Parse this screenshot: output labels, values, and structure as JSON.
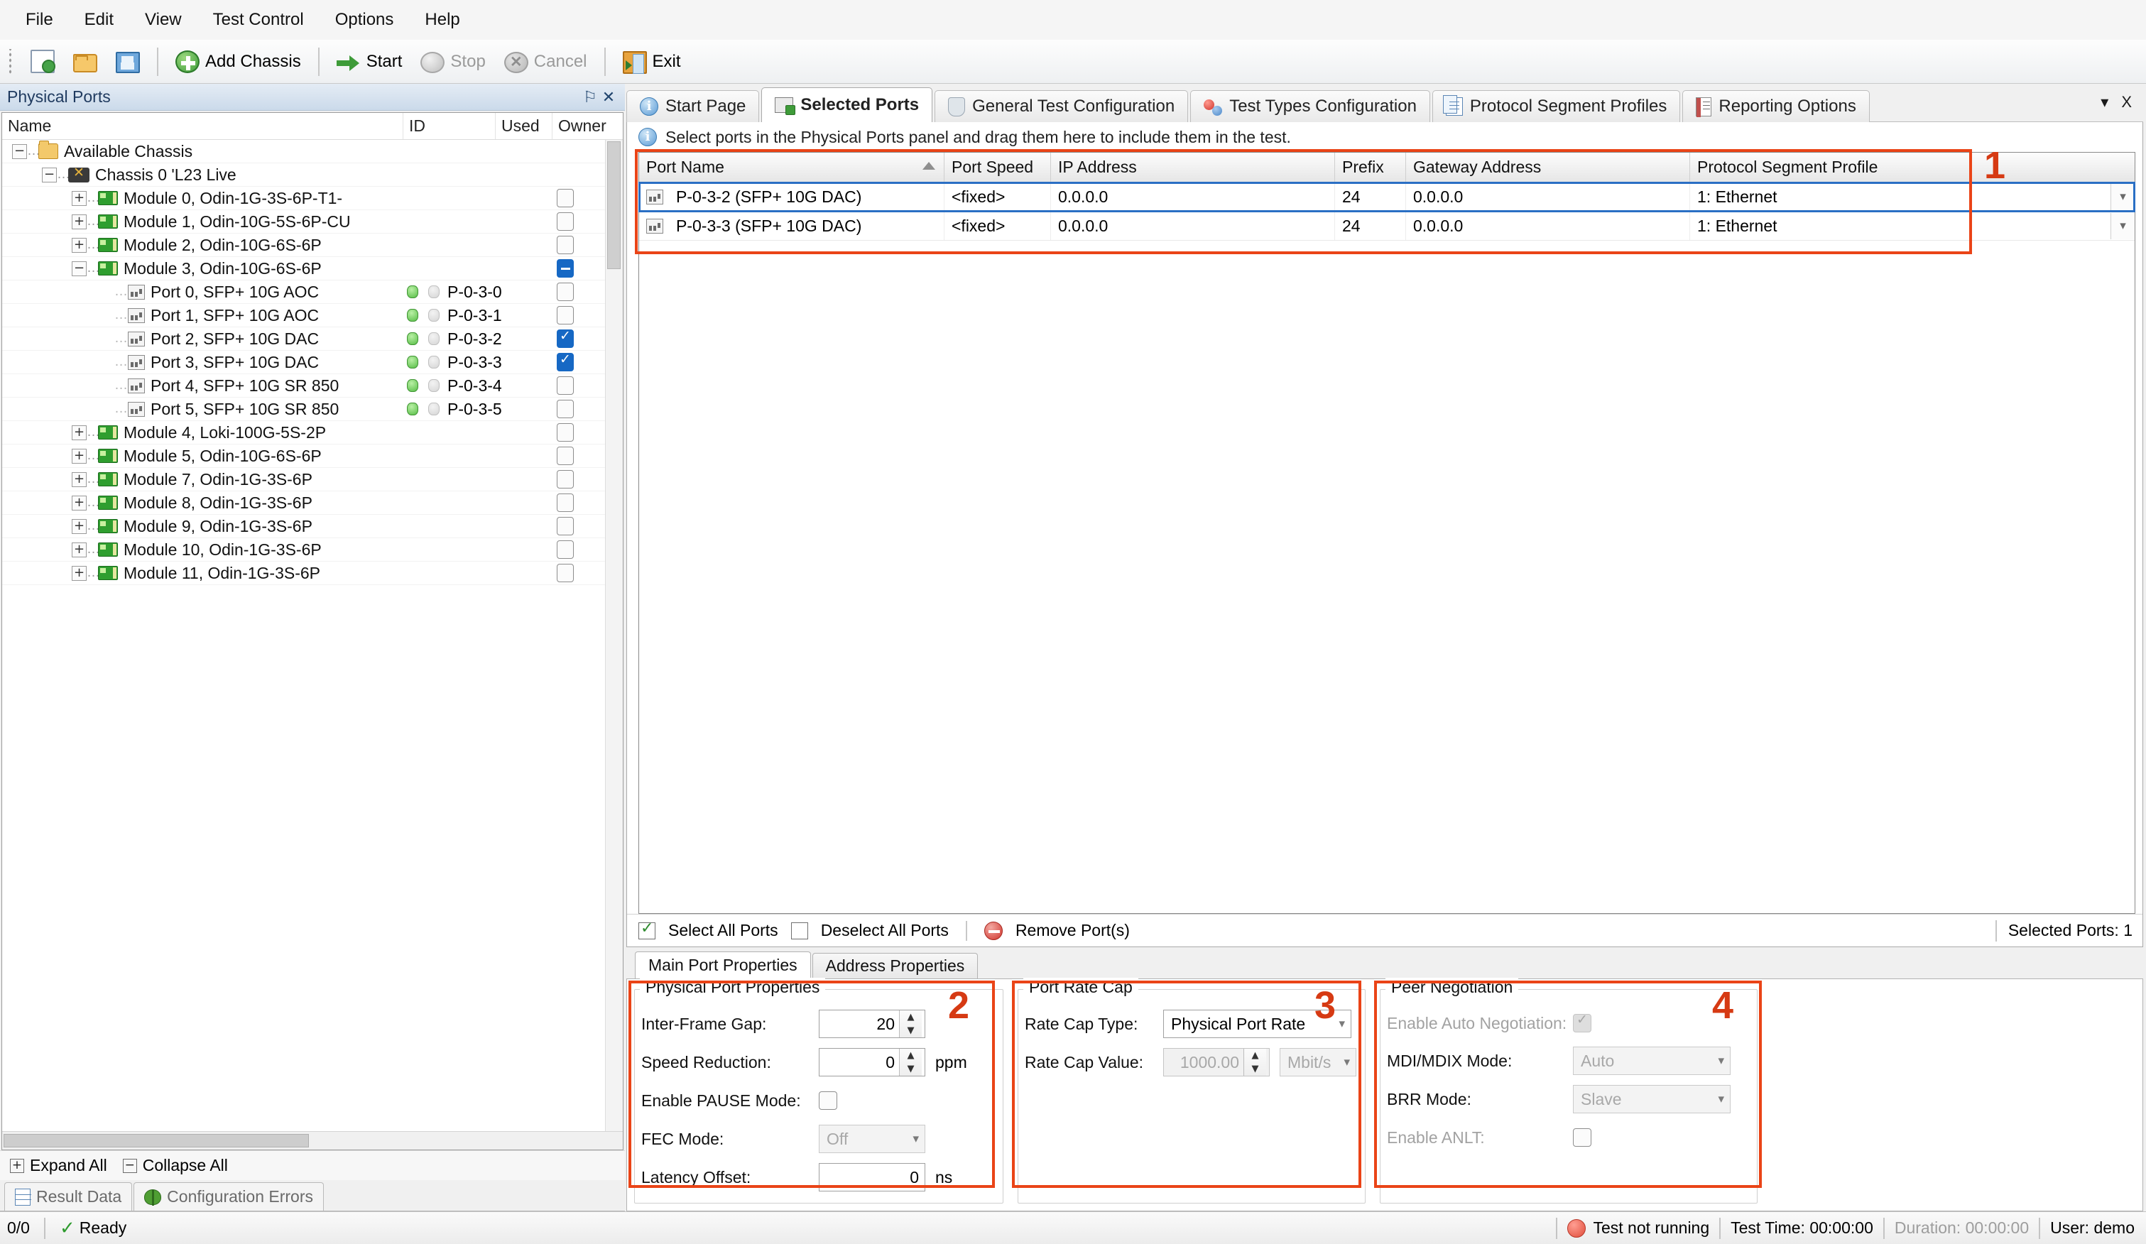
{
  "menu": {
    "items": [
      "File",
      "Edit",
      "View",
      "Test Control",
      "Options",
      "Help"
    ]
  },
  "toolbar": {
    "new_label": "",
    "open_label": "",
    "save_label": "",
    "add_chassis_label": "Add Chassis",
    "start_label": "Start",
    "stop_label": "Stop",
    "cancel_label": "Cancel",
    "exit_label": "Exit"
  },
  "physical_ports_panel": {
    "title": "Physical Ports",
    "pin_icon": "⚐",
    "close_icon": "✕",
    "columns": [
      "Name",
      "ID",
      "Used",
      "Owner"
    ],
    "rows": [
      {
        "label": "Available Chassis",
        "level": 0,
        "icon": "folder-icon",
        "expander": "−",
        "id": "",
        "used": "none",
        "led": false
      },
      {
        "label": "Chassis 0 'L23 Live",
        "level": 1,
        "icon": "chassis-icon",
        "expander": "−",
        "id": "",
        "used": "none",
        "led": false
      },
      {
        "label": "Module 0, Odin-1G-3S-6P-T1-",
        "level": 2,
        "icon": "module-icon",
        "expander": "+",
        "id": "",
        "used": "unchecked",
        "led": false
      },
      {
        "label": "Module 1, Odin-10G-5S-6P-CU",
        "level": 2,
        "icon": "module-icon",
        "expander": "+",
        "id": "",
        "used": "unchecked",
        "led": false
      },
      {
        "label": "Module 2, Odin-10G-6S-6P",
        "level": 2,
        "icon": "module-icon",
        "expander": "+",
        "id": "",
        "used": "unchecked",
        "led": false
      },
      {
        "label": "Module 3, Odin-10G-6S-6P",
        "level": 2,
        "icon": "module-icon",
        "expander": "−",
        "id": "",
        "used": "partial",
        "led": false
      },
      {
        "label": "Port 0, SFP+ 10G AOC",
        "level": 3,
        "icon": "port-icon",
        "expander": "",
        "id": "P-0-3-0",
        "used": "unchecked",
        "led": true
      },
      {
        "label": "Port 1, SFP+ 10G AOC",
        "level": 3,
        "icon": "port-icon",
        "expander": "",
        "id": "P-0-3-1",
        "used": "unchecked",
        "led": true
      },
      {
        "label": "Port 2, SFP+ 10G DAC",
        "level": 3,
        "icon": "port-icon",
        "expander": "",
        "id": "P-0-3-2",
        "used": "checked",
        "led": true
      },
      {
        "label": "Port 3, SFP+ 10G DAC",
        "level": 3,
        "icon": "port-icon",
        "expander": "",
        "id": "P-0-3-3",
        "used": "checked",
        "led": true
      },
      {
        "label": "Port 4, SFP+ 10G SR 850",
        "level": 3,
        "icon": "port-icon",
        "expander": "",
        "id": "P-0-3-4",
        "used": "unchecked",
        "led": true
      },
      {
        "label": "Port 5, SFP+ 10G SR 850",
        "level": 3,
        "icon": "port-icon",
        "expander": "",
        "id": "P-0-3-5",
        "used": "unchecked",
        "led": true
      },
      {
        "label": "Module 4, Loki-100G-5S-2P",
        "level": 2,
        "icon": "module-icon",
        "expander": "+",
        "id": "",
        "used": "unchecked",
        "led": false
      },
      {
        "label": "Module 5, Odin-10G-6S-6P",
        "level": 2,
        "icon": "module-icon",
        "expander": "+",
        "id": "",
        "used": "unchecked",
        "led": false
      },
      {
        "label": "Module 7, Odin-1G-3S-6P",
        "level": 2,
        "icon": "module-icon",
        "expander": "+",
        "id": "",
        "used": "unchecked",
        "led": false
      },
      {
        "label": "Module 8, Odin-1G-3S-6P",
        "level": 2,
        "icon": "module-icon",
        "expander": "+",
        "id": "",
        "used": "unchecked",
        "led": false
      },
      {
        "label": "Module 9, Odin-1G-3S-6P",
        "level": 2,
        "icon": "module-icon",
        "expander": "+",
        "id": "",
        "used": "unchecked",
        "led": false
      },
      {
        "label": "Module 10, Odin-1G-3S-6P",
        "level": 2,
        "icon": "module-icon",
        "expander": "+",
        "id": "",
        "used": "unchecked",
        "led": false
      },
      {
        "label": "Module 11, Odin-1G-3S-6P",
        "level": 2,
        "icon": "module-icon",
        "expander": "+",
        "id": "",
        "used": "unchecked",
        "led": false
      }
    ],
    "expand_all_label": "Expand All",
    "collapse_all_label": "Collapse All"
  },
  "bottom_tabs": [
    {
      "label": "Result Data",
      "icon": "grid-icon",
      "active": false
    },
    {
      "label": "Configuration Errors",
      "icon": "bug-icon",
      "active": false
    }
  ],
  "main_tabs": [
    {
      "label": "Start Page",
      "icon": "info-icon",
      "active": false
    },
    {
      "label": "Selected Ports",
      "icon": "selected-ports-icon",
      "active": true
    },
    {
      "label": "General Test Configuration",
      "icon": "shield-icon",
      "active": false
    },
    {
      "label": "Test Types Configuration",
      "icon": "balloons-icon",
      "active": false
    },
    {
      "label": "Protocol Segment Profiles",
      "icon": "documents-icon",
      "active": false
    },
    {
      "label": "Reporting Options",
      "icon": "report-icon",
      "active": false
    }
  ],
  "window_controls": {
    "dropdown_icon": "▾",
    "close_icon": "X"
  },
  "hint": {
    "icon": "info-icon",
    "text": "Select ports in the Physical Ports panel and drag them here to include them in the test."
  },
  "port_grid": {
    "columns": [
      "Port Name",
      "Port Speed",
      "IP Address",
      "Prefix",
      "Gateway Address",
      "Protocol Segment Profile"
    ],
    "sort_column": "Port Name",
    "sort_direction": "ascending",
    "rows": [
      {
        "port_name": "P-0-3-2 (SFP+ 10G DAC)",
        "port_speed": "<fixed>",
        "ip_address": "0.0.0.0",
        "prefix": "24",
        "gateway_address": "0.0.0.0",
        "protocol_segment_profile": "1: Ethernet",
        "selected": true
      },
      {
        "port_name": "P-0-3-3 (SFP+ 10G DAC)",
        "port_speed": "<fixed>",
        "ip_address": "0.0.0.0",
        "prefix": "24",
        "gateway_address": "0.0.0.0",
        "protocol_segment_profile": "1: Ethernet",
        "selected": false
      }
    ]
  },
  "selection_bar": {
    "select_all_label": "Select All Ports",
    "deselect_all_label": "Deselect All Ports",
    "remove_ports_label": "Remove Port(s)",
    "selected_ports_label": "Selected Ports: 1"
  },
  "property_tabs": [
    {
      "label": "Main Port Properties",
      "active": true
    },
    {
      "label": "Address Properties",
      "active": false
    }
  ],
  "physical_port_properties": {
    "group_title": "Physical Port Properties",
    "inter_frame_gap": {
      "label": "Inter-Frame Gap:",
      "value": "20"
    },
    "speed_reduction": {
      "label": "Speed Reduction:",
      "value": "0",
      "unit": "ppm"
    },
    "enable_pause_mode": {
      "label": "Enable PAUSE Mode:",
      "checked": false
    },
    "fec_mode": {
      "label": "FEC Mode:",
      "value": "Off",
      "disabled": true
    },
    "latency_offset": {
      "label": "Latency Offset:",
      "value": "0",
      "unit": "ns"
    }
  },
  "port_rate_cap": {
    "group_title": "Port Rate Cap",
    "rate_cap_type": {
      "label": "Rate Cap Type:",
      "value": "Physical Port Rate"
    },
    "rate_cap_value": {
      "label": "Rate Cap Value:",
      "value": "1000.00",
      "unit": "Mbit/s",
      "disabled": true
    }
  },
  "peer_negotiation": {
    "group_title": "Peer Negotiation",
    "enable_auto_negotiation": {
      "label": "Enable Auto Negotiation:",
      "checked": true,
      "disabled": true
    },
    "mdi_mdix_mode": {
      "label": "MDI/MDIX Mode:",
      "value": "Auto",
      "disabled": true
    },
    "brr_mode": {
      "label": "BRR Mode:",
      "value": "Slave",
      "disabled": true
    },
    "enable_anlt": {
      "label": "Enable ANLT:",
      "checked": false,
      "disabled": true
    }
  },
  "annotations": [
    {
      "number": "1"
    },
    {
      "number": "2"
    },
    {
      "number": "3"
    },
    {
      "number": "4"
    }
  ],
  "statusbar": {
    "counter": "0/0",
    "ready_label": "Ready",
    "test_state": "Test not running",
    "test_time": "Test Time: 00:00:00",
    "duration": "Duration: 00:00:00",
    "user": "User: demo"
  },
  "colors": {
    "annotation": "#ea4417",
    "selection": "#2a6fc4",
    "checkbox_checked": "#1668c4",
    "ok_green": "#2e9b2e",
    "stop_red": "#e04d3b"
  }
}
